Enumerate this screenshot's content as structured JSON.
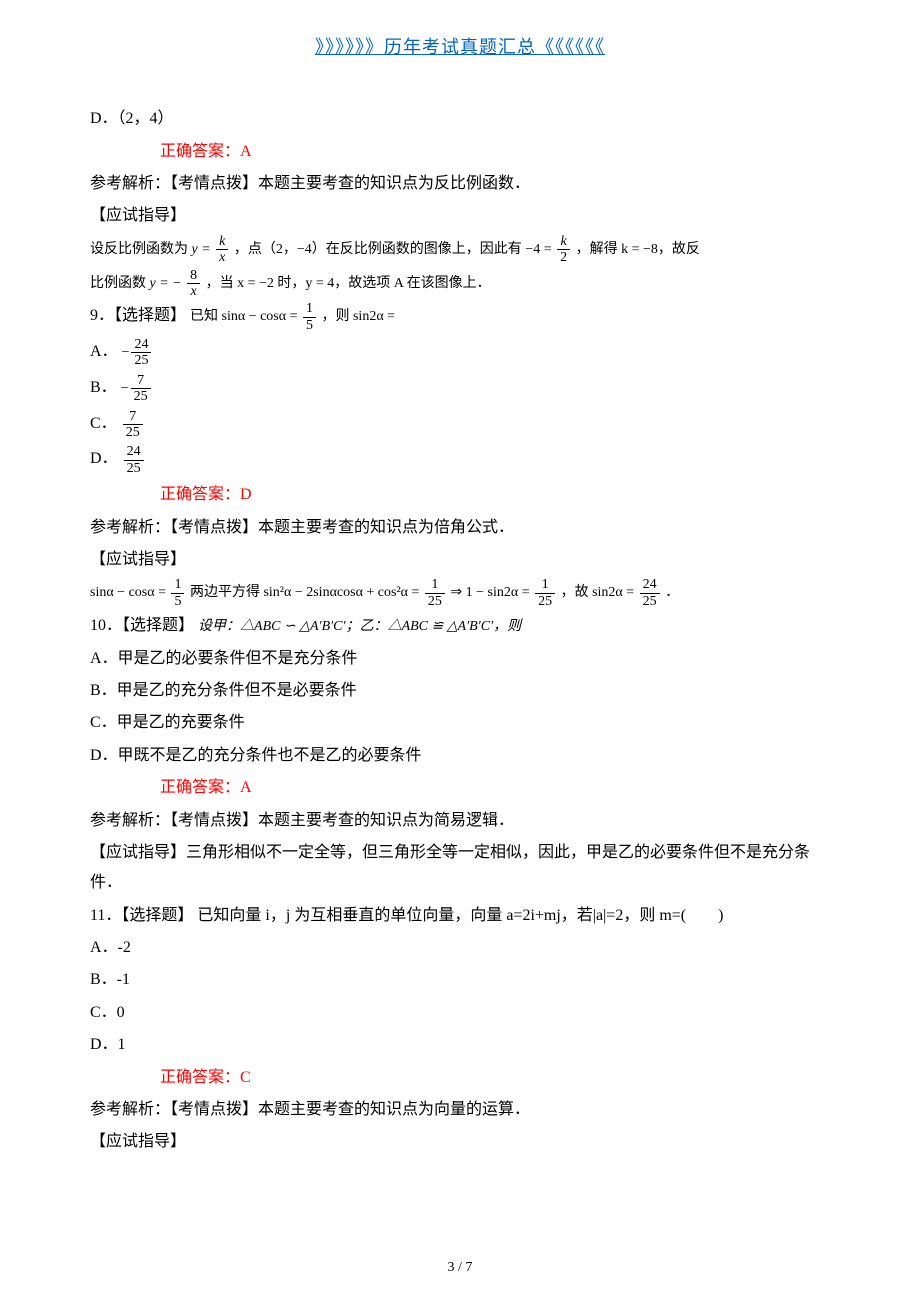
{
  "header": {
    "link_text": "》》》》》》历年考试真题汇总《《《《《《"
  },
  "q8": {
    "opt_d": "D．（2，4）",
    "answer": "正确答案：A",
    "analysis_prefix": "参考解析：【考情点拨】本题主要考查的知识点为反比例函数．",
    "guide_label": "【应试指导】",
    "guide_line1_a": "设反比例函数为",
    "guide_line1_b": "，点（2，−4）在反比例函数的图像上，因此有",
    "guide_line1_c": "，解得 k = −8，故反",
    "guide_line2_a": "比例函数",
    "guide_line2_b": "，当 x = −2 时，y = 4，故选项 A 在该图像上．"
  },
  "q9": {
    "label": "9．【选择题】",
    "stem_a": "已知 sinα − cosα =",
    "stem_b": "，则 sin2α =",
    "opt_a_prefix": "A．",
    "opt_b_prefix": "B．",
    "opt_c_prefix": "C．",
    "opt_d_prefix": "D．",
    "answer": "正确答案：D",
    "analysis": "参考解析：【考情点拨】本题主要考查的知识点为倍角公式．",
    "guide_label": "【应试指导】",
    "guide_a": "sinα − cosα =",
    "guide_b": " 两边平方得 sin²α − 2sinαcosα + cos²α =",
    "guide_c": " ⇒ 1 − sin2α =",
    "guide_d": "，故 sin2α =",
    "guide_e": "．"
  },
  "q10": {
    "label": "10．【选择题】",
    "stem": "设甲：△ABC ∽ △A′B′C′；乙：△ABC ≌ △A′B′C′，则",
    "opt_a": "A．甲是乙的必要条件但不是充分条件",
    "opt_b": "B．甲是乙的充分条件但不是必要条件",
    "opt_c": "C．甲是乙的充要条件",
    "opt_d": "D．甲既不是乙的充分条件也不是乙的必要条件",
    "answer": "正确答案：A",
    "analysis": "参考解析：【考情点拨】本题主要考查的知识点为简易逻辑．",
    "guide": "【应试指导】三角形相似不一定全等，但三角形全等一定相似，因此，甲是乙的必要条件但不是充分条件．"
  },
  "q11": {
    "label": "11．【选择题】",
    "stem": "已知向量 i，j 为互相垂直的单位向量，向量 a=2i+mj，若|a|=2，则 m=(　　)",
    "opt_a": "A．-2",
    "opt_b": "B．-1",
    "opt_c": "C．0",
    "opt_d": "D．1",
    "answer": "正确答案：C",
    "analysis": "参考解析：【考情点拨】本题主要考查的知识点为向量的运算．",
    "guide_label": "【应试指导】"
  },
  "pagenum": "3 / 7"
}
